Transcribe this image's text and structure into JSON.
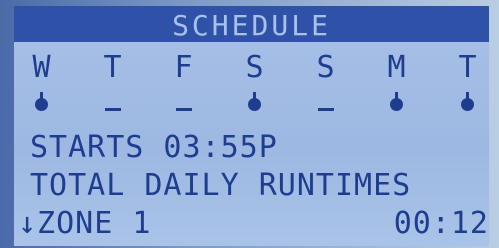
{
  "screen": {
    "title": "SCHEDULE",
    "days": [
      {
        "label": "W",
        "watering": true
      },
      {
        "label": "T",
        "watering": false
      },
      {
        "label": "F",
        "watering": false
      },
      {
        "label": "S",
        "watering": true
      },
      {
        "label": "S",
        "watering": false
      },
      {
        "label": "M",
        "watering": true
      },
      {
        "label": "T",
        "watering": true
      }
    ],
    "starts_label": "STARTS 03:55P",
    "runtimes_label": "TOTAL DAILY RUNTIMES",
    "zone_label": "↓ZONE 1",
    "zone_time": "00:12"
  },
  "colors": {
    "lcd_background": "#a7c0e7",
    "lcd_text": "#1f3d8f",
    "title_bar": "#2f52a8"
  }
}
